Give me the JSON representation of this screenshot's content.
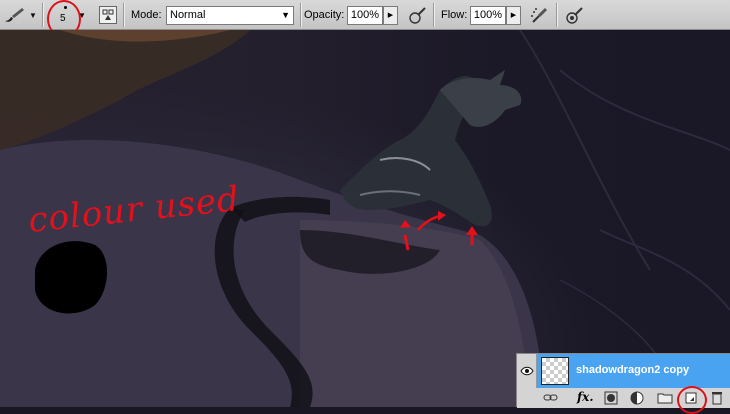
{
  "options_bar": {
    "tool_preset_icon": "brush-icon",
    "brush_size": "5",
    "mode_label": "Mode:",
    "mode_value": "Normal",
    "opacity_label": "Opacity:",
    "opacity_value": "100%",
    "flow_label": "Flow:",
    "flow_value": "100%",
    "icons": [
      "brush-panel-icon",
      "pressure-opacity-icon",
      "airbrush-icon",
      "pressure-size-icon"
    ]
  },
  "canvas": {
    "annotation_text": "colour used",
    "annotation_color": "#e4101c",
    "swatch_color": "#000000"
  },
  "layers_panel": {
    "layer_name": "shadowdragon2 copy",
    "selected_color": "#4aa3f0",
    "footer_icons": [
      "link-icon",
      "fx-icon",
      "mask-icon",
      "adjustment-icon",
      "group-icon",
      "new-layer-icon",
      "trash-icon"
    ],
    "fx_label": "fx."
  }
}
